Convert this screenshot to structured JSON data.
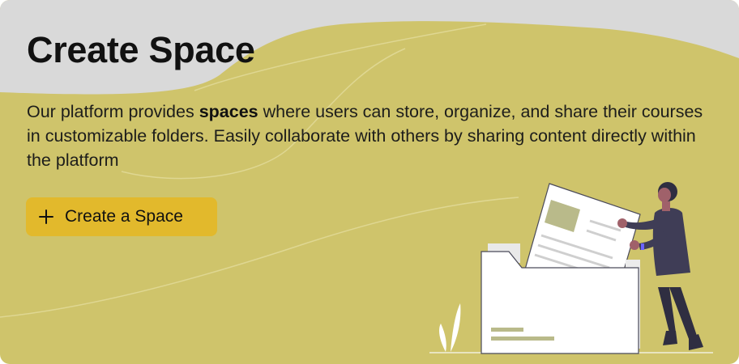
{
  "page": {
    "title": "Create Space",
    "description": {
      "before": "Our platform provides ",
      "bold": "spaces",
      "after": " where users can store, organize, and share their courses in customizable folders. Easily collaborate with others by sharing content directly within the platform"
    }
  },
  "cta": {
    "icon": "plus-icon",
    "label": "Create a Space"
  },
  "illustration": {
    "icon": "person-filing-documents-illustration"
  },
  "colors": {
    "background": "#cfc46b",
    "header_blob": "#d9d9d9",
    "button": "#e2b92c",
    "text": "#111111"
  }
}
